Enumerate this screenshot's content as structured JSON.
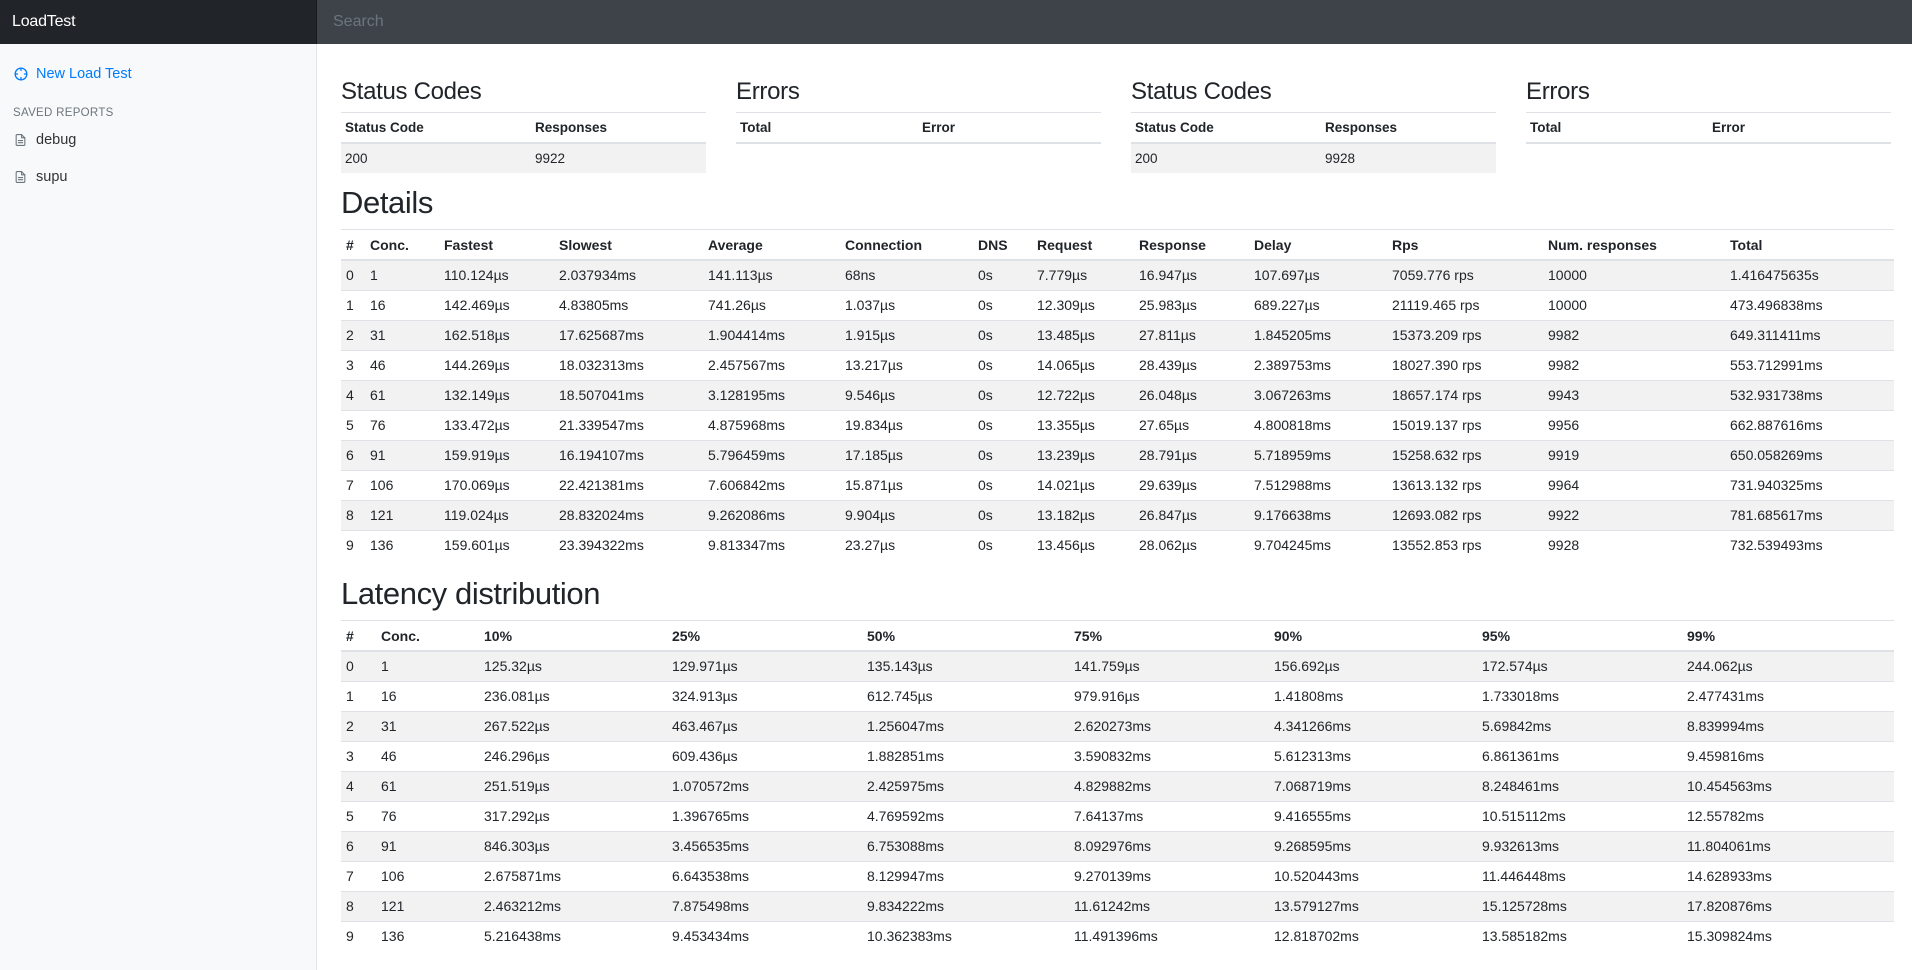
{
  "app": {
    "brand": "LoadTest",
    "search_placeholder": "Search"
  },
  "sidebar": {
    "new_test_label": "New Load Test",
    "saved_heading": "SAVED REPORTS",
    "reports": [
      "debug",
      "supu"
    ]
  },
  "colors": {
    "accent": "#007bff",
    "topbar": "#343a40",
    "brand_bg": "#212529",
    "stripe": "#f2f2f2"
  },
  "icons": {
    "new_test": "crosshair-icon",
    "report": "file-text-icon"
  },
  "status_codes": [
    {
      "title": "Status Codes",
      "headers": [
        "Status Code",
        "Responses"
      ],
      "rows": [
        [
          "200",
          "9922"
        ]
      ]
    },
    {
      "title": "Status Codes",
      "headers": [
        "Status Code",
        "Responses"
      ],
      "rows": [
        [
          "200",
          "9928"
        ]
      ]
    }
  ],
  "errors": [
    {
      "title": "Errors",
      "headers": [
        "Total",
        "Error"
      ],
      "rows": []
    },
    {
      "title": "Errors",
      "headers": [
        "Total",
        "Error"
      ],
      "rows": []
    }
  ],
  "details": {
    "title": "Details",
    "headers": [
      "#",
      "Conc.",
      "Fastest",
      "Slowest",
      "Average",
      "Connection",
      "DNS",
      "Request",
      "Response",
      "Delay",
      "Rps",
      "Num. responses",
      "Total"
    ],
    "rows": [
      [
        "0",
        "1",
        "110.124µs",
        "2.037934ms",
        "141.113µs",
        "68ns",
        "0s",
        "7.779µs",
        "16.947µs",
        "107.697µs",
        "7059.776 rps",
        "10000",
        "1.416475635s"
      ],
      [
        "1",
        "16",
        "142.469µs",
        "4.83805ms",
        "741.26µs",
        "1.037µs",
        "0s",
        "12.309µs",
        "25.983µs",
        "689.227µs",
        "21119.465 rps",
        "10000",
        "473.496838ms"
      ],
      [
        "2",
        "31",
        "162.518µs",
        "17.625687ms",
        "1.904414ms",
        "1.915µs",
        "0s",
        "13.485µs",
        "27.811µs",
        "1.845205ms",
        "15373.209 rps",
        "9982",
        "649.311411ms"
      ],
      [
        "3",
        "46",
        "144.269µs",
        "18.032313ms",
        "2.457567ms",
        "13.217µs",
        "0s",
        "14.065µs",
        "28.439µs",
        "2.389753ms",
        "18027.390 rps",
        "9982",
        "553.712991ms"
      ],
      [
        "4",
        "61",
        "132.149µs",
        "18.507041ms",
        "3.128195ms",
        "9.546µs",
        "0s",
        "12.722µs",
        "26.048µs",
        "3.067263ms",
        "18657.174 rps",
        "9943",
        "532.931738ms"
      ],
      [
        "5",
        "76",
        "133.472µs",
        "21.339547ms",
        "4.875968ms",
        "19.834µs",
        "0s",
        "13.355µs",
        "27.65µs",
        "4.800818ms",
        "15019.137 rps",
        "9956",
        "662.887616ms"
      ],
      [
        "6",
        "91",
        "159.919µs",
        "16.194107ms",
        "5.796459ms",
        "17.185µs",
        "0s",
        "13.239µs",
        "28.791µs",
        "5.718959ms",
        "15258.632 rps",
        "9919",
        "650.058269ms"
      ],
      [
        "7",
        "106",
        "170.069µs",
        "22.421381ms",
        "7.606842ms",
        "15.871µs",
        "0s",
        "14.021µs",
        "29.639µs",
        "7.512988ms",
        "13613.132 rps",
        "9964",
        "731.940325ms"
      ],
      [
        "8",
        "121",
        "119.024µs",
        "28.832024ms",
        "9.262086ms",
        "9.904µs",
        "0s",
        "13.182µs",
        "26.847µs",
        "9.176638ms",
        "12693.082 rps",
        "9922",
        "781.685617ms"
      ],
      [
        "9",
        "136",
        "159.601µs",
        "23.394322ms",
        "9.813347ms",
        "23.27µs",
        "0s",
        "13.456µs",
        "28.062µs",
        "9.704245ms",
        "13552.853 rps",
        "9928",
        "732.539493ms"
      ]
    ]
  },
  "latency": {
    "title": "Latency distribution",
    "headers": [
      "#",
      "Conc.",
      "10%",
      "25%",
      "50%",
      "75%",
      "90%",
      "95%",
      "99%"
    ],
    "rows": [
      [
        "0",
        "1",
        "125.32µs",
        "129.971µs",
        "135.143µs",
        "141.759µs",
        "156.692µs",
        "172.574µs",
        "244.062µs"
      ],
      [
        "1",
        "16",
        "236.081µs",
        "324.913µs",
        "612.745µs",
        "979.916µs",
        "1.41808ms",
        "1.733018ms",
        "2.477431ms"
      ],
      [
        "2",
        "31",
        "267.522µs",
        "463.467µs",
        "1.256047ms",
        "2.620273ms",
        "4.341266ms",
        "5.69842ms",
        "8.839994ms"
      ],
      [
        "3",
        "46",
        "246.296µs",
        "609.436µs",
        "1.882851ms",
        "3.590832ms",
        "5.612313ms",
        "6.861361ms",
        "9.459816ms"
      ],
      [
        "4",
        "61",
        "251.519µs",
        "1.070572ms",
        "2.425975ms",
        "4.829882ms",
        "7.068719ms",
        "8.248461ms",
        "10.454563ms"
      ],
      [
        "5",
        "76",
        "317.292µs",
        "1.396765ms",
        "4.769592ms",
        "7.64137ms",
        "9.416555ms",
        "10.515112ms",
        "12.55782ms"
      ],
      [
        "6",
        "91",
        "846.303µs",
        "3.456535ms",
        "6.753088ms",
        "8.092976ms",
        "9.268595ms",
        "9.932613ms",
        "11.804061ms"
      ],
      [
        "7",
        "106",
        "2.675871ms",
        "6.643538ms",
        "8.129947ms",
        "9.270139ms",
        "10.520443ms",
        "11.446448ms",
        "14.628933ms"
      ],
      [
        "8",
        "121",
        "2.463212ms",
        "7.875498ms",
        "9.834222ms",
        "11.61242ms",
        "13.579127ms",
        "15.125728ms",
        "17.820876ms"
      ],
      [
        "9",
        "136",
        "5.216438ms",
        "9.453434ms",
        "10.362383ms",
        "11.491396ms",
        "12.818702ms",
        "13.585182ms",
        "15.309824ms"
      ]
    ]
  }
}
